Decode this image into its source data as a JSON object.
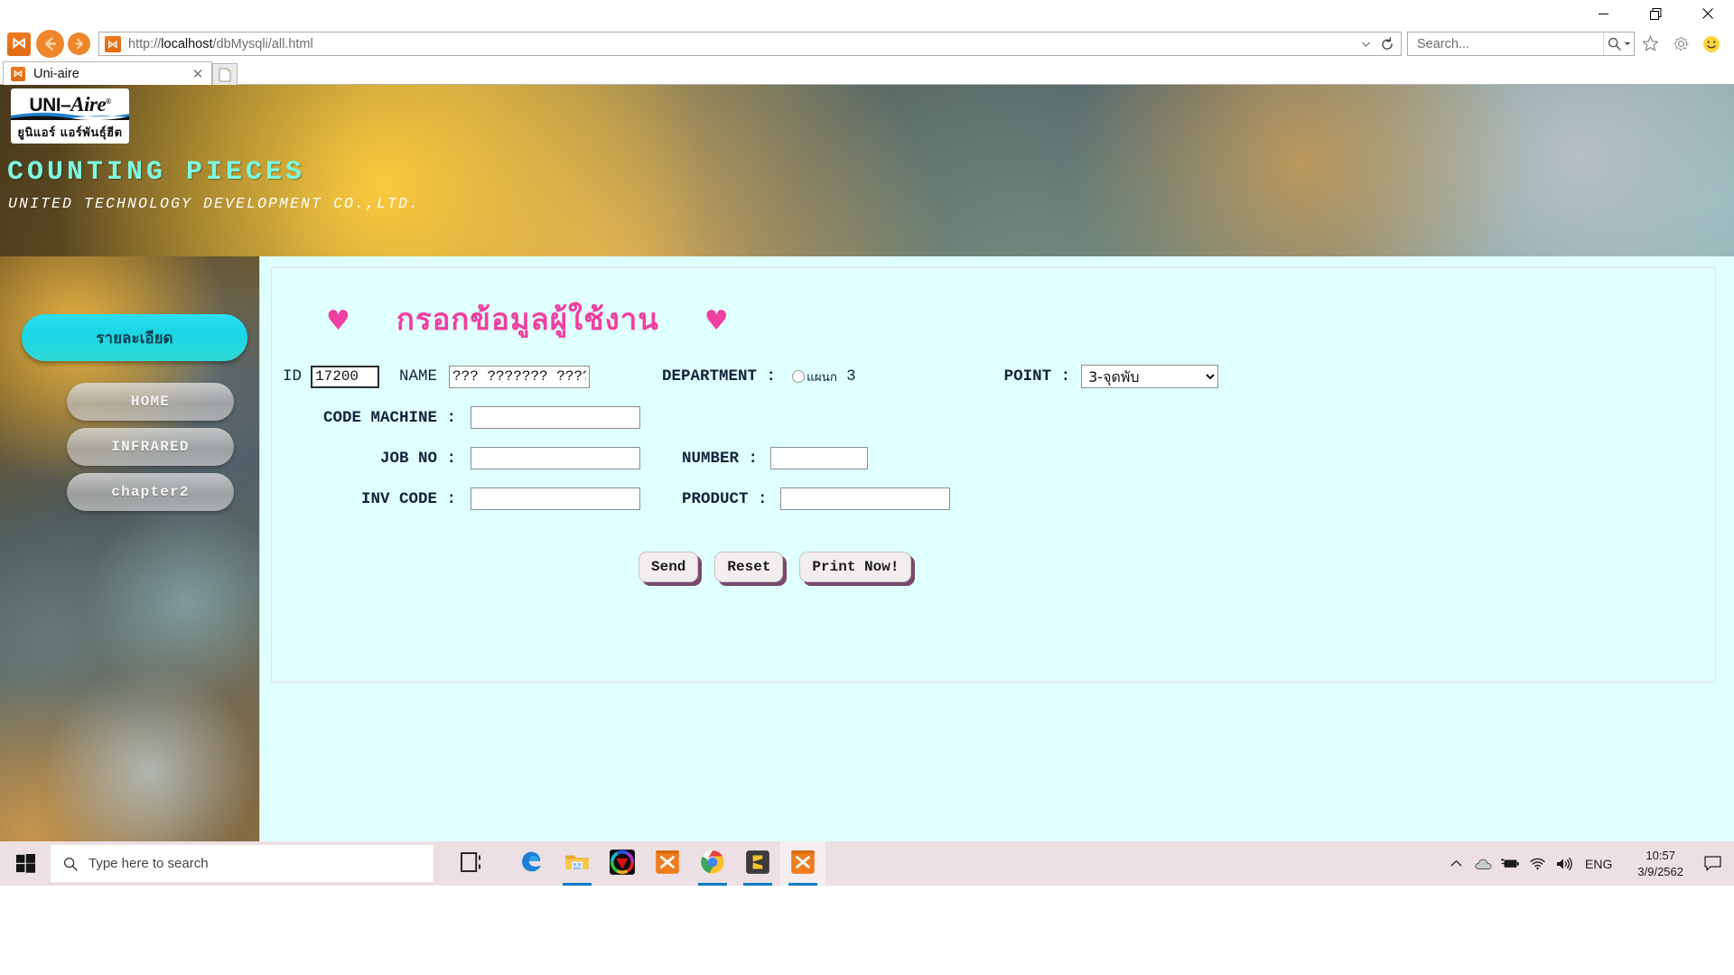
{
  "window": {
    "minimize_icon": "minimize-icon",
    "restore_icon": "restore-icon",
    "close_icon": "close-icon"
  },
  "browser": {
    "app_icon": "xampp-icon",
    "back_icon": "back-arrow-icon",
    "forward_icon": "forward-arrow-icon",
    "address": {
      "protocol": "http://",
      "host": "localhost",
      "path": "/dbMysqli/all.html",
      "full": "http://localhost/dbMysqli/all.html",
      "favicon": "xampp-icon",
      "dropdown_icon": "chevron-down-icon",
      "reload_icon": "refresh-icon"
    },
    "search": {
      "placeholder": "Search...",
      "icon": "search-icon",
      "dropdown_icon": "chevron-down-icon"
    },
    "toolbar_icons": [
      "favorites-star-icon",
      "tools-gear-icon",
      "smiley-feedback-icon"
    ],
    "tab": {
      "title": "Uni-aire",
      "favicon": "xampp-icon",
      "close_icon": "close-icon"
    },
    "new_tab_icon": "new-tab-icon"
  },
  "banner": {
    "logo_main": "UNI-Aire",
    "logo_reg": "®",
    "logo_thai": "ยูนิแอร์  แอร์พันธุ์ฮีต",
    "heading": "COUNTING PIECES",
    "subheading": "UNITED TECHNOLOGY DEVELOPMENT CO.,LTD.",
    "heading_color": "#7dfadf"
  },
  "sidebar": {
    "items": [
      {
        "label": "รายละเอียด",
        "style": "primary",
        "color": "#1ad6e6"
      },
      {
        "label": "HOME",
        "style": "ghost"
      },
      {
        "label": "INFRARED",
        "style": "ghost"
      },
      {
        "label": "chapter2",
        "style": "ghost"
      }
    ]
  },
  "form": {
    "title": "กรอกข้อมูลผู้ใช้งาน",
    "title_heart": "♥",
    "title_color": "#ef3fa0",
    "fields": {
      "id_label": "ID",
      "id_value": "17200",
      "name_label": "NAME",
      "name_value": "??? ??????? ??????",
      "department_label": "DEPARTMENT  :",
      "department_option": "แผนก",
      "department_number": "3",
      "department_checked": false,
      "point_label": "POINT  :",
      "point_value": "3-จุดพับ",
      "point_options": [
        "3-จุดพับ"
      ],
      "code_machine_label": "CODE MACHINE  :",
      "code_machine_value": "",
      "job_no_label": "JOB NO  :",
      "job_no_value": "",
      "number_label": "NUMBER  :",
      "number_value": "",
      "inv_code_label": "INV CODE  :",
      "inv_code_value": "",
      "product_label": "PRODUCT  :",
      "product_value": ""
    },
    "buttons": {
      "send": "Send",
      "reset": "Reset",
      "print": "Print Now!"
    }
  },
  "taskbar": {
    "start_icon": "windows-start-icon",
    "search_placeholder": "Type here to search",
    "search_icon": "search-icon",
    "task_view_icon": "task-view-icon",
    "apps": [
      {
        "name": "microsoft-edge-icon",
        "running": false
      },
      {
        "name": "file-explorer-icon",
        "running": true
      },
      {
        "name": "color-wheel-app-icon",
        "running": false
      },
      {
        "name": "xampp-control-panel-icon",
        "running": false
      },
      {
        "name": "google-chrome-icon",
        "running": true
      },
      {
        "name": "sublime-text-icon",
        "running": true
      },
      {
        "name": "xampp-icon",
        "running": true,
        "active": true
      }
    ],
    "tray": {
      "overflow_icon": "chevron-up-icon",
      "onedrive_icon": "cloud-icon",
      "battery_icon": "battery-charging-icon",
      "wifi_icon": "wifi-icon",
      "volume_icon": "speaker-icon",
      "language": "ENG",
      "time": "10:57",
      "date": "3/9/2562",
      "notification_icon": "notification-icon"
    }
  }
}
